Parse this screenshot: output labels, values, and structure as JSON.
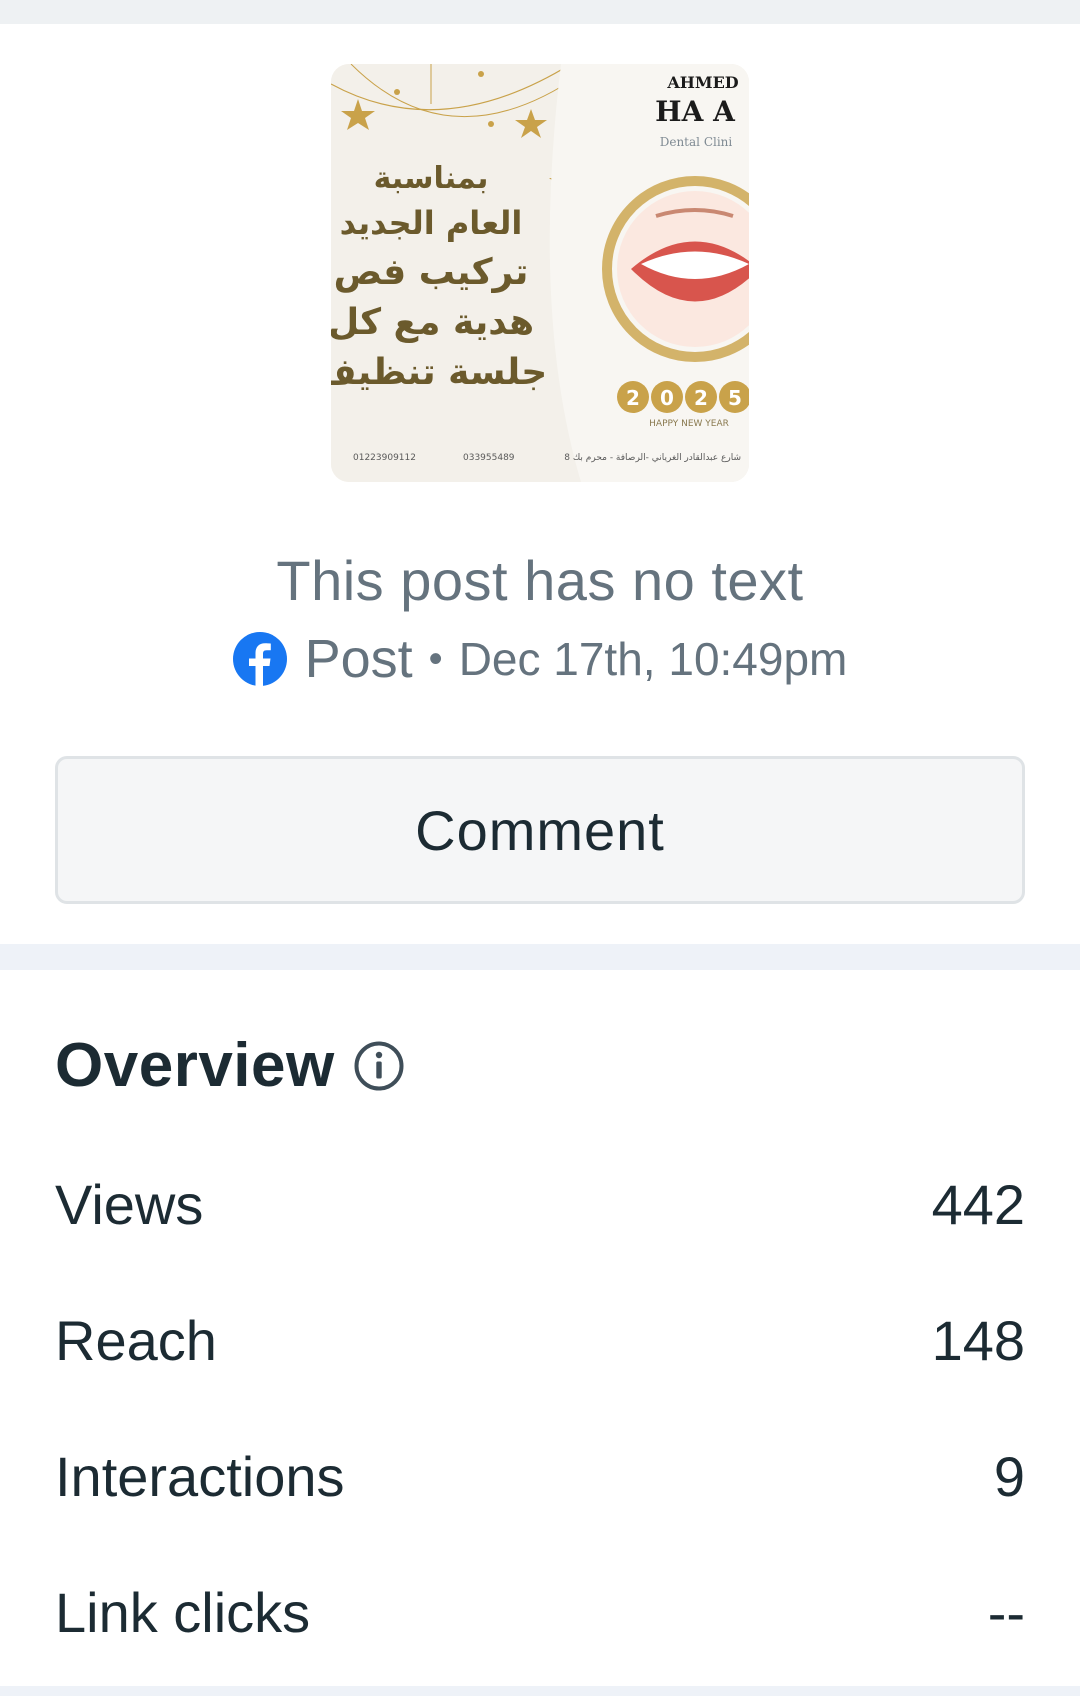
{
  "post": {
    "image_text": {
      "brand_top": "AHMED",
      "brand_main": "HA A",
      "brand_sub": "Dental Clini",
      "arabic_lines": [
        "بمناسبة",
        "العام الجديد",
        "تركيب فص",
        "هدية مع كل",
        "جلسة تنظيف"
      ],
      "year": "2025",
      "year_caption": "HAPPY NEW YEAR",
      "phone_1": "01223909112",
      "phone_2": "033955489",
      "address": "8 شارع عبدالقادر الغرياني -الرصافة - محرم بك"
    },
    "no_text_label": "This post has no text",
    "type_label": "Post",
    "separator": "•",
    "date": "Dec 17th, 10:49pm",
    "platform_icon": "facebook-icon"
  },
  "actions": {
    "comment_label": "Comment"
  },
  "overview": {
    "title": "Overview",
    "info_icon": "info-icon",
    "metrics": [
      {
        "label": "Views",
        "value": "442"
      },
      {
        "label": "Reach",
        "value": "148"
      },
      {
        "label": "Interactions",
        "value": "9"
      },
      {
        "label": "Link clicks",
        "value": "--"
      }
    ]
  },
  "colors": {
    "facebook_blue": "#1877f2",
    "text_primary": "#1c2b33",
    "text_secondary": "#65737e",
    "gold": "#c9a24a"
  }
}
